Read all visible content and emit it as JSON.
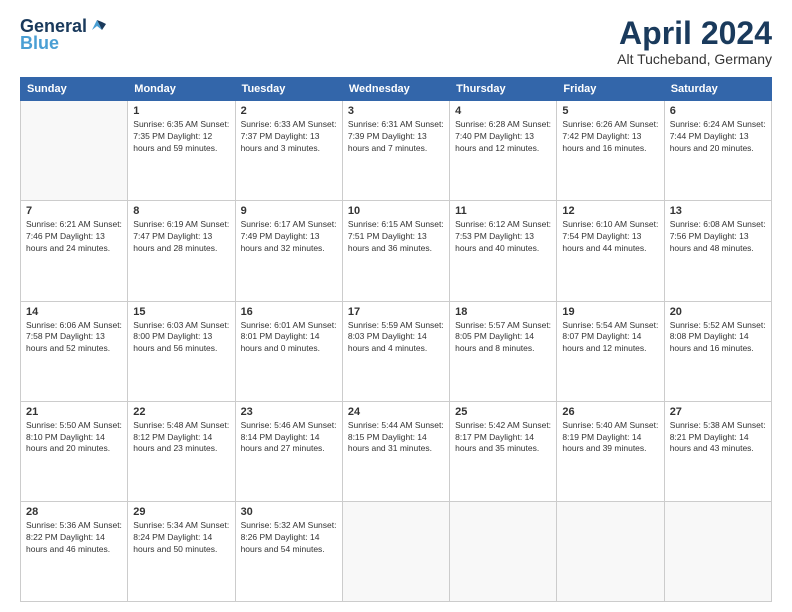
{
  "header": {
    "logo_line1": "General",
    "logo_line2": "Blue",
    "month": "April 2024",
    "location": "Alt Tucheband, Germany"
  },
  "days_of_week": [
    "Sunday",
    "Monday",
    "Tuesday",
    "Wednesday",
    "Thursday",
    "Friday",
    "Saturday"
  ],
  "weeks": [
    [
      {
        "day": "",
        "info": ""
      },
      {
        "day": "1",
        "info": "Sunrise: 6:35 AM\nSunset: 7:35 PM\nDaylight: 12 hours\nand 59 minutes."
      },
      {
        "day": "2",
        "info": "Sunrise: 6:33 AM\nSunset: 7:37 PM\nDaylight: 13 hours\nand 3 minutes."
      },
      {
        "day": "3",
        "info": "Sunrise: 6:31 AM\nSunset: 7:39 PM\nDaylight: 13 hours\nand 7 minutes."
      },
      {
        "day": "4",
        "info": "Sunrise: 6:28 AM\nSunset: 7:40 PM\nDaylight: 13 hours\nand 12 minutes."
      },
      {
        "day": "5",
        "info": "Sunrise: 6:26 AM\nSunset: 7:42 PM\nDaylight: 13 hours\nand 16 minutes."
      },
      {
        "day": "6",
        "info": "Sunrise: 6:24 AM\nSunset: 7:44 PM\nDaylight: 13 hours\nand 20 minutes."
      }
    ],
    [
      {
        "day": "7",
        "info": "Sunrise: 6:21 AM\nSunset: 7:46 PM\nDaylight: 13 hours\nand 24 minutes."
      },
      {
        "day": "8",
        "info": "Sunrise: 6:19 AM\nSunset: 7:47 PM\nDaylight: 13 hours\nand 28 minutes."
      },
      {
        "day": "9",
        "info": "Sunrise: 6:17 AM\nSunset: 7:49 PM\nDaylight: 13 hours\nand 32 minutes."
      },
      {
        "day": "10",
        "info": "Sunrise: 6:15 AM\nSunset: 7:51 PM\nDaylight: 13 hours\nand 36 minutes."
      },
      {
        "day": "11",
        "info": "Sunrise: 6:12 AM\nSunset: 7:53 PM\nDaylight: 13 hours\nand 40 minutes."
      },
      {
        "day": "12",
        "info": "Sunrise: 6:10 AM\nSunset: 7:54 PM\nDaylight: 13 hours\nand 44 minutes."
      },
      {
        "day": "13",
        "info": "Sunrise: 6:08 AM\nSunset: 7:56 PM\nDaylight: 13 hours\nand 48 minutes."
      }
    ],
    [
      {
        "day": "14",
        "info": "Sunrise: 6:06 AM\nSunset: 7:58 PM\nDaylight: 13 hours\nand 52 minutes."
      },
      {
        "day": "15",
        "info": "Sunrise: 6:03 AM\nSunset: 8:00 PM\nDaylight: 13 hours\nand 56 minutes."
      },
      {
        "day": "16",
        "info": "Sunrise: 6:01 AM\nSunset: 8:01 PM\nDaylight: 14 hours\nand 0 minutes."
      },
      {
        "day": "17",
        "info": "Sunrise: 5:59 AM\nSunset: 8:03 PM\nDaylight: 14 hours\nand 4 minutes."
      },
      {
        "day": "18",
        "info": "Sunrise: 5:57 AM\nSunset: 8:05 PM\nDaylight: 14 hours\nand 8 minutes."
      },
      {
        "day": "19",
        "info": "Sunrise: 5:54 AM\nSunset: 8:07 PM\nDaylight: 14 hours\nand 12 minutes."
      },
      {
        "day": "20",
        "info": "Sunrise: 5:52 AM\nSunset: 8:08 PM\nDaylight: 14 hours\nand 16 minutes."
      }
    ],
    [
      {
        "day": "21",
        "info": "Sunrise: 5:50 AM\nSunset: 8:10 PM\nDaylight: 14 hours\nand 20 minutes."
      },
      {
        "day": "22",
        "info": "Sunrise: 5:48 AM\nSunset: 8:12 PM\nDaylight: 14 hours\nand 23 minutes."
      },
      {
        "day": "23",
        "info": "Sunrise: 5:46 AM\nSunset: 8:14 PM\nDaylight: 14 hours\nand 27 minutes."
      },
      {
        "day": "24",
        "info": "Sunrise: 5:44 AM\nSunset: 8:15 PM\nDaylight: 14 hours\nand 31 minutes."
      },
      {
        "day": "25",
        "info": "Sunrise: 5:42 AM\nSunset: 8:17 PM\nDaylight: 14 hours\nand 35 minutes."
      },
      {
        "day": "26",
        "info": "Sunrise: 5:40 AM\nSunset: 8:19 PM\nDaylight: 14 hours\nand 39 minutes."
      },
      {
        "day": "27",
        "info": "Sunrise: 5:38 AM\nSunset: 8:21 PM\nDaylight: 14 hours\nand 43 minutes."
      }
    ],
    [
      {
        "day": "28",
        "info": "Sunrise: 5:36 AM\nSunset: 8:22 PM\nDaylight: 14 hours\nand 46 minutes."
      },
      {
        "day": "29",
        "info": "Sunrise: 5:34 AM\nSunset: 8:24 PM\nDaylight: 14 hours\nand 50 minutes."
      },
      {
        "day": "30",
        "info": "Sunrise: 5:32 AM\nSunset: 8:26 PM\nDaylight: 14 hours\nand 54 minutes."
      },
      {
        "day": "",
        "info": ""
      },
      {
        "day": "",
        "info": ""
      },
      {
        "day": "",
        "info": ""
      },
      {
        "day": "",
        "info": ""
      }
    ]
  ]
}
